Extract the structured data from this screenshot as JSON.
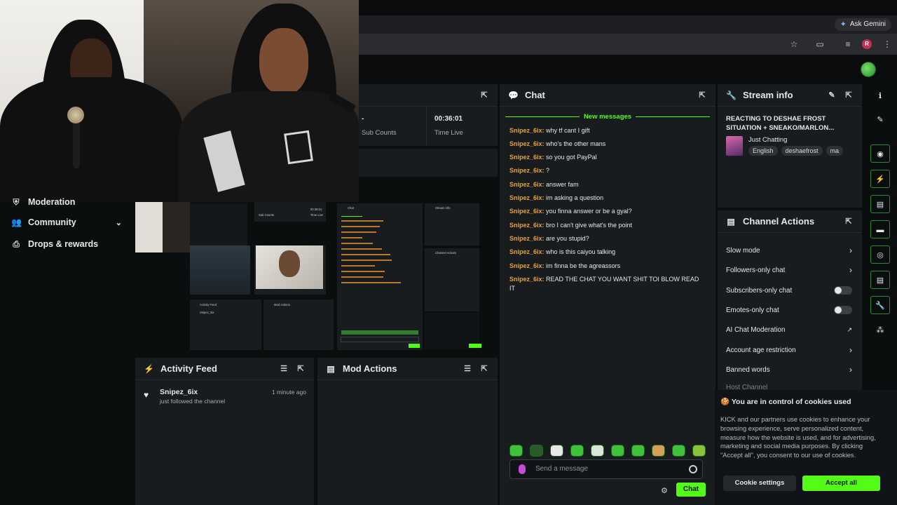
{
  "browser": {
    "gemini_label": "Ask Gemini",
    "profile_initial": "R"
  },
  "left_nav": {
    "items": [
      {
        "label": "Moderation",
        "icon": "shield-icon"
      },
      {
        "label": "Community",
        "icon": "users-icon"
      },
      {
        "label": "Drops & rewards",
        "icon": "gift-icon"
      }
    ]
  },
  "stats": {
    "sub_counts_value": "-",
    "sub_counts_label": "Sub Counts",
    "time_live_value": "00:36:01",
    "time_live_label": "Time Live"
  },
  "chat": {
    "title": "Chat",
    "new_messages": "New messages",
    "messages": [
      {
        "user": "Snipez_6ix:",
        "text": "why tf cant I gift"
      },
      {
        "user": "Snipez_6ix:",
        "text": "who's the other mans"
      },
      {
        "user": "Snipez_6ix:",
        "text": "so you got PayPal"
      },
      {
        "user": "Snipez_6ix:",
        "text": "?"
      },
      {
        "user": "Snipez_6ix:",
        "text": "answer fam"
      },
      {
        "user": "Snipez_6ix:",
        "text": "im asking a question"
      },
      {
        "user": "Snipez_6ix:",
        "text": "you finna answer or be a gyal?"
      },
      {
        "user": "Snipez_6ix:",
        "text": "bro I can't give what's the point"
      },
      {
        "user": "Snipez_6ix:",
        "text": "are you stupid?"
      },
      {
        "user": "Snipez_6ix:",
        "text": "who is this caiyou talking"
      },
      {
        "user": "Snipez_6ix:",
        "text": "im finna be the agreassors"
      },
      {
        "user": "Snipez_6ix:",
        "text": "READ THE CHAT YOU WANT SHIT TOI BLOW READ IT"
      }
    ],
    "input_placeholder": "Send a message",
    "send_label": "Chat"
  },
  "stream_info": {
    "title": "Stream info",
    "stream_title": "REACTING TO DESHAE FROST SITUATION + SNEAKO/MARLON...",
    "category": "Just Chatting",
    "tags": [
      "English",
      "deshaefrost",
      "ma"
    ]
  },
  "channel_actions": {
    "title": "Channel Actions",
    "items": [
      {
        "label": "Slow mode",
        "control": "chevron"
      },
      {
        "label": "Followers-only chat",
        "control": "chevron"
      },
      {
        "label": "Subscribers-only chat",
        "control": "toggle",
        "on": false
      },
      {
        "label": "Emotes-only chat",
        "control": "toggle",
        "on": false
      },
      {
        "label": "AI Chat Moderation",
        "control": "external"
      },
      {
        "label": "Account age restriction",
        "control": "chevron"
      },
      {
        "label": "Banned words",
        "control": "chevron"
      },
      {
        "label": "Host Channel",
        "control": "none"
      }
    ]
  },
  "activity_feed": {
    "title": "Activity Feed",
    "events": [
      {
        "user": "Snipez_6ix",
        "action": "just followed the channel",
        "time": "1 minute ago"
      }
    ]
  },
  "mod_actions": {
    "title": "Mod Actions"
  },
  "cookie": {
    "title": "You are in control of cookies used",
    "body": "KICK and our partners use cookies to enhance your browsing experience, serve personalized content, measure how the website is used, and for advertising, marketing and social media purposes. By clicking \"Accept all\", you consent to our use of cookies.",
    "settings_label": "Cookie settings",
    "accept_label": "Accept all"
  },
  "colors": {
    "accent": "#53fc18",
    "username": "#e8a13a",
    "panel": "#181c1e",
    "background": "#0b0e0f"
  }
}
